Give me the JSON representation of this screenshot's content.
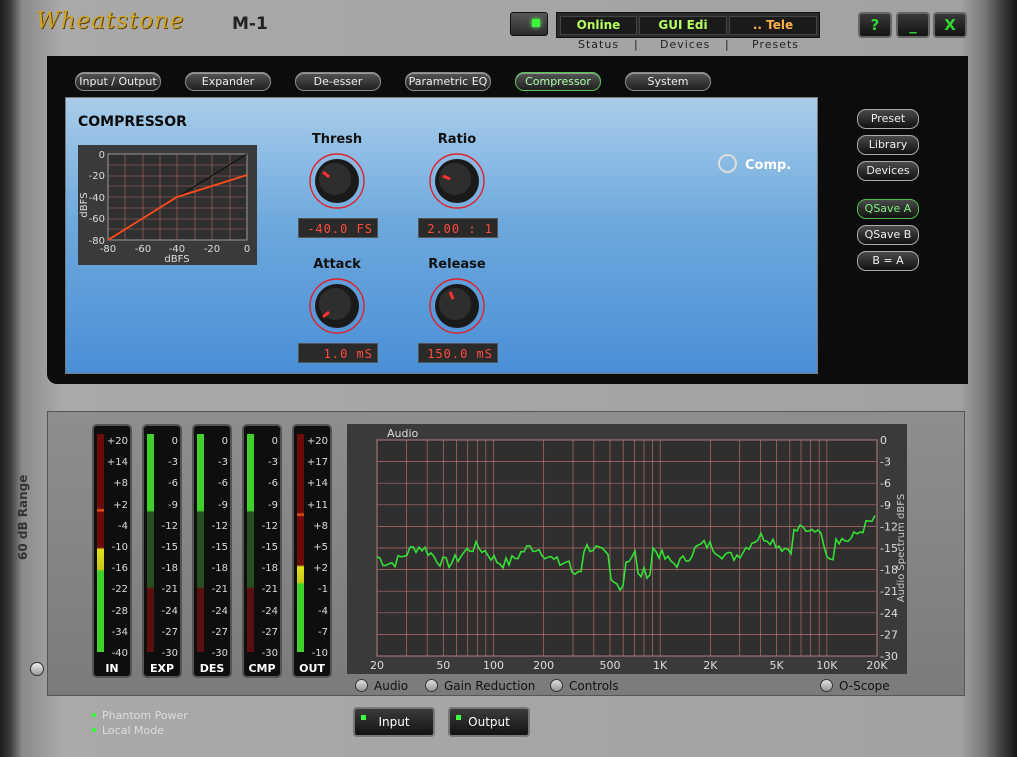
{
  "header": {
    "brand": "Wheatstone",
    "model": "M-1",
    "status_boxes": [
      {
        "text": "Online",
        "color": "#b5ff62"
      },
      {
        "text": "GUI Edi",
        "color": "#b5ff62"
      },
      {
        "text": ".. Tele",
        "color": "#ffb14a"
      }
    ],
    "status_labels": [
      "Status",
      "|",
      "Devices",
      "|",
      "Presets"
    ],
    "window_buttons": [
      "?",
      "_",
      "X"
    ]
  },
  "tabs": [
    {
      "label": "Input / Output",
      "active": false
    },
    {
      "label": "Expander",
      "active": false
    },
    {
      "label": "De-esser",
      "active": false
    },
    {
      "label": "Parametric EQ",
      "active": false
    },
    {
      "label": "Compressor",
      "active": true
    },
    {
      "label": "System",
      "active": false
    }
  ],
  "compressor": {
    "title": "COMPRESSOR",
    "graph": {
      "x_ticks": [
        "-80",
        "-60",
        "-40",
        "-20",
        "0"
      ],
      "y_ticks": [
        "0",
        "-20",
        "-40",
        "-60",
        "-80"
      ],
      "xlabel": "dBFS",
      "ylabel": "dBFS"
    },
    "controls": [
      {
        "label": "Thresh",
        "value": "-40.0 FS"
      },
      {
        "label": "Ratio",
        "value": "2.00 : 1"
      },
      {
        "label": "Attack",
        "value": "1.0 mS"
      },
      {
        "label": "Release",
        "value": "150.0 mS"
      }
    ],
    "comp_toggle": "Comp."
  },
  "side_buttons": [
    {
      "label": "Preset",
      "active": false
    },
    {
      "label": "Library",
      "active": false
    },
    {
      "label": "Devices",
      "active": false
    },
    {
      "label": "QSave A",
      "active": true
    },
    {
      "label": "QSave B",
      "active": false
    },
    {
      "label": "B = A",
      "active": false
    }
  ],
  "meters": [
    {
      "label": "IN",
      "ticks": [
        "+20",
        "+14",
        "+8",
        "+2",
        "-4",
        "-10",
        "-16",
        "-22",
        "-28",
        "-34",
        "-40"
      ]
    },
    {
      "label": "EXP",
      "ticks": [
        "0",
        "-3",
        "-6",
        "-9",
        "-12",
        "-15",
        "-18",
        "-21",
        "-24",
        "-27",
        "-30"
      ]
    },
    {
      "label": "DES",
      "ticks": [
        "0",
        "-3",
        "-6",
        "-9",
        "-12",
        "-15",
        "-18",
        "-21",
        "-24",
        "-27",
        "-30"
      ]
    },
    {
      "label": "CMP",
      "ticks": [
        "0",
        "-3",
        "-6",
        "-9",
        "-12",
        "-15",
        "-18",
        "-21",
        "-24",
        "-27",
        "-30"
      ]
    },
    {
      "label": "OUT",
      "ticks": [
        "+20",
        "+17",
        "+14",
        "+11",
        "+8",
        "+5",
        "+2",
        "-1",
        "-4",
        "-7",
        "-10"
      ]
    }
  ],
  "range_label": "60 dB Range",
  "spectrum": {
    "title": "Audio",
    "ylabel": "Audio Spectrum dBFS",
    "x_ticks": [
      "20",
      "50",
      "100",
      "200",
      "500",
      "1K",
      "2K",
      "5K",
      "10K",
      "20K"
    ],
    "y_ticks": [
      "0",
      "-3",
      "-6",
      "-9",
      "-12",
      "-15",
      "-18",
      "-21",
      "-24",
      "-27",
      "-30"
    ]
  },
  "view_options": [
    "Audio",
    "Gain Reduction",
    "Controls",
    "O-Scope"
  ],
  "bottom_buttons": [
    "Input",
    "Output"
  ],
  "status_indicators": [
    "Phantom Power",
    "Local Mode"
  ]
}
